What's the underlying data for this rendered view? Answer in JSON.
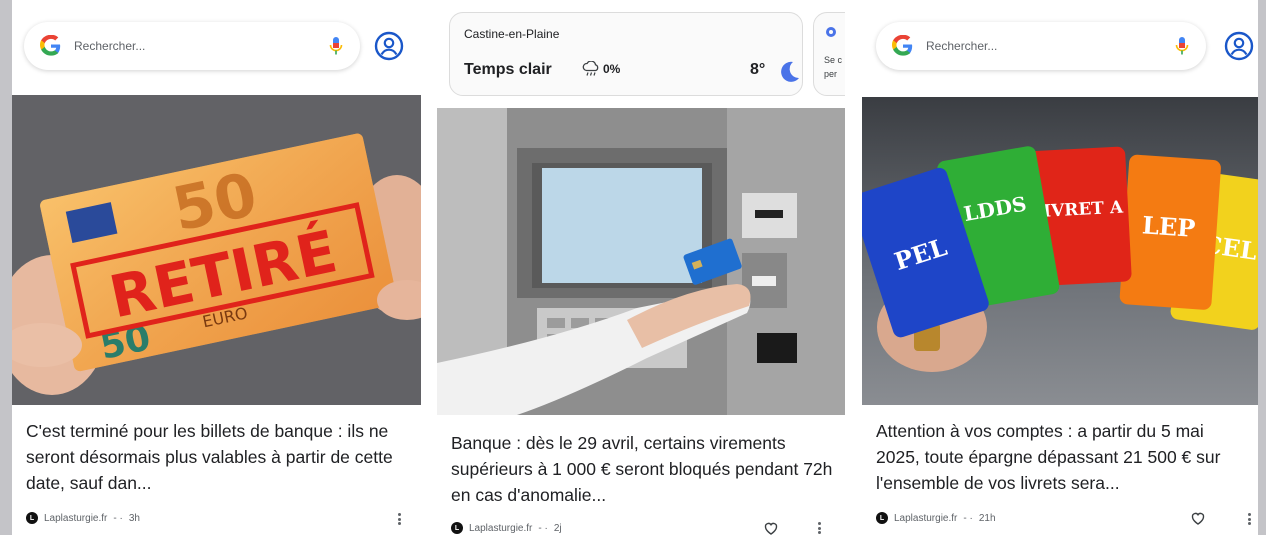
{
  "search": {
    "placeholder": "Rechercher..."
  },
  "weather": {
    "city": "Castine-en-Plaine",
    "condition": "Temps clair",
    "precipitation": "0%",
    "temperature": "8°",
    "next_card_line1": "Se c",
    "next_card_line2": "per"
  },
  "articles": [
    {
      "image_caption": {
        "banknote_value": "50",
        "stamp": "RETIRÉ",
        "banknote_word": "EURO"
      },
      "headline": "C'est terminé pour les billets de banque : ils ne seront désormais plus valables à partir de cette date, sauf dan...",
      "source": "Laplasturgie.fr",
      "time": "3h"
    },
    {
      "headline": "Banque : dès le 29 avril, certains virements supérieurs à 1 000 € seront bloqués pendant 72h en cas d'anomalie...",
      "source": "Laplasturgie.fr",
      "time": "2j"
    },
    {
      "image_caption": {
        "cards": [
          "PEL",
          "LDDS",
          "LIVRET A",
          "LEP",
          "CEL"
        ]
      },
      "headline": "Attention à vos comptes : a partir du 5 mai 2025, toute épargne dépassant 21 500 € sur l'ensemble de vos livrets sera...",
      "source": "Laplasturgie.fr",
      "time": "21h"
    }
  ],
  "meta_separator": " - · ",
  "colors": {
    "google_blue": "#4285F4",
    "google_red": "#EA4335",
    "google_yellow": "#FBBC05",
    "google_green": "#34A853",
    "account_blue": "#1a57c9"
  },
  "icons": [
    "google-logo-icon",
    "mic-icon",
    "account-icon",
    "rain-cloud-icon",
    "moon-icon",
    "gear-icon",
    "heart-icon",
    "more-vert-icon"
  ]
}
